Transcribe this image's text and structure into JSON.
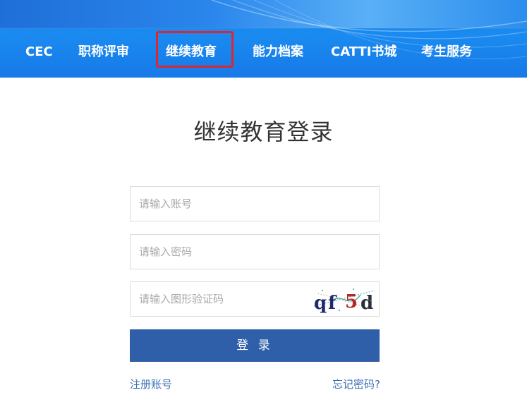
{
  "nav": {
    "items": [
      {
        "label": "CEC"
      },
      {
        "label": "职称评审"
      },
      {
        "label": "继续教育"
      },
      {
        "label": "能力档案"
      },
      {
        "label": "CATTI书城"
      },
      {
        "label": "考生服务"
      }
    ],
    "active": "继续教育",
    "highlight_color": "#e0262d"
  },
  "login": {
    "title": "继续教育登录",
    "account_placeholder": "请输入账号",
    "password_placeholder": "请输入密码",
    "captcha_placeholder": "请输入图形验证码",
    "captcha_text": "qf5d",
    "submit_label": "登 录",
    "register_link": "注册账号",
    "forgot_link": "忘记密码?"
  },
  "colors": {
    "banner": "#1a8bf0",
    "button": "#2f5fa8",
    "link": "#3d6fb6"
  }
}
